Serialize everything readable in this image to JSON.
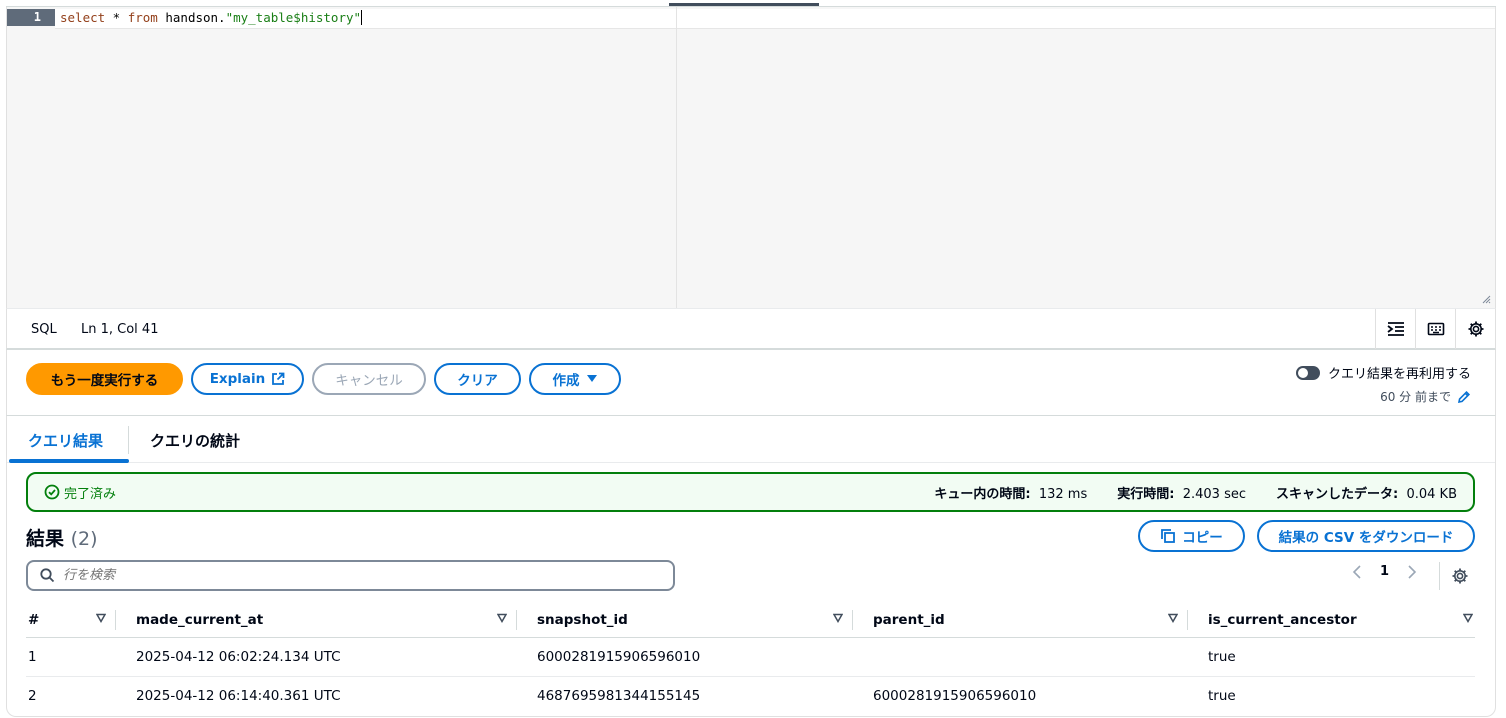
{
  "editor": {
    "line_number": "1",
    "code": {
      "kw1": "select",
      "mid1": " * ",
      "kw2": "from",
      "mid2": " handson.",
      "str": "\"my_table$history\""
    }
  },
  "statusbar": {
    "language": "SQL",
    "position": "Ln 1, Col 41",
    "icons": [
      "indent-icon",
      "keyboard-icon",
      "settings-icon"
    ]
  },
  "actions": {
    "run_again": "もう一度実行する",
    "explain": "Explain",
    "cancel": "キャンセル",
    "clear": "クリア",
    "create": "作成",
    "reuse_toggle_label": "クエリ結果を再利用する",
    "reuse_toggle_on": false,
    "reuse_sub": "60 分 前まで"
  },
  "results": {
    "tabs": [
      "クエリ結果",
      "クエリの統計"
    ],
    "active_tab": 0,
    "status": "完了済み",
    "metrics": {
      "queue_label": "キュー内の時間:",
      "queue_value": "132 ms",
      "exec_label": "実行時間:",
      "exec_value": "2.403 sec",
      "scan_label": "スキャンしたデータ:",
      "scan_value": "0.04 KB"
    },
    "title": "結果",
    "count": "(2)",
    "copy": "コピー",
    "download_csv": "結果の CSV をダウンロード",
    "search_placeholder": "行を検索",
    "page": "1",
    "columns": [
      "#",
      "made_current_at",
      "snapshot_id",
      "parent_id",
      "is_current_ancestor"
    ],
    "rows": [
      [
        "1",
        "2025-04-12 06:02:24.134 UTC",
        "6000281915906596010",
        "",
        "true"
      ],
      [
        "2",
        "2025-04-12 06:14:40.361 UTC",
        "4687695981344155145",
        "6000281915906596010",
        "true"
      ]
    ]
  },
  "colors": {
    "primary": "#ff9900",
    "link": "#0972d3",
    "success": "#037f0c"
  }
}
